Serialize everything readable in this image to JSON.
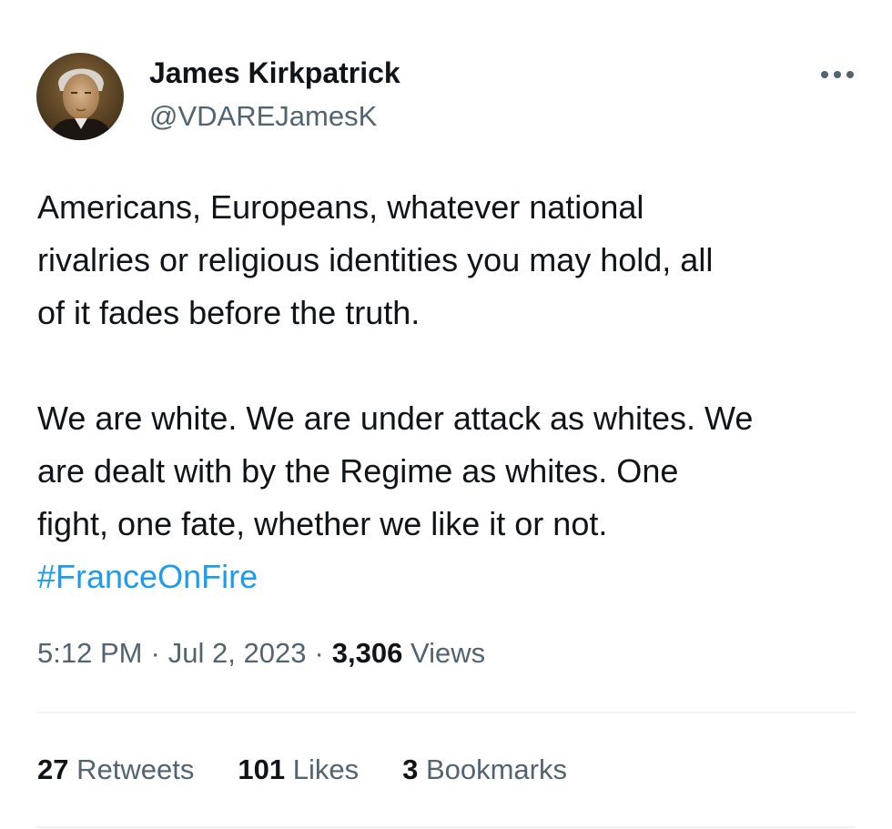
{
  "author": {
    "display_name": "James Kirkpatrick",
    "handle": "@VDAREJamesK"
  },
  "tweet": {
    "lines_para1": [
      "Americans, Europeans, whatever national",
      "rivalries or religious identities you may hold, all",
      "of it fades before the truth."
    ],
    "lines_para2": [
      "We are white. We are under attack as whites. We",
      "are dealt with by the Regime as whites. One",
      "fight, one fate, whether we like it or not."
    ],
    "hashtag": "#FranceOnFire"
  },
  "meta": {
    "time": "5:12 PM",
    "separator": "·",
    "date": "Jul 2, 2023",
    "views_count": "3,306",
    "views_label": "Views"
  },
  "stats": {
    "retweets_count": "27",
    "retweets_label": "Retweets",
    "likes_count": "101",
    "likes_label": "Likes",
    "bookmarks_count": "3",
    "bookmarks_label": "Bookmarks"
  },
  "icons": {
    "more": "more-horizontal-icon"
  },
  "colors": {
    "text_primary": "#0f1419",
    "text_secondary": "#536471",
    "link": "#1d9bf0",
    "divider": "#eff3f4"
  }
}
